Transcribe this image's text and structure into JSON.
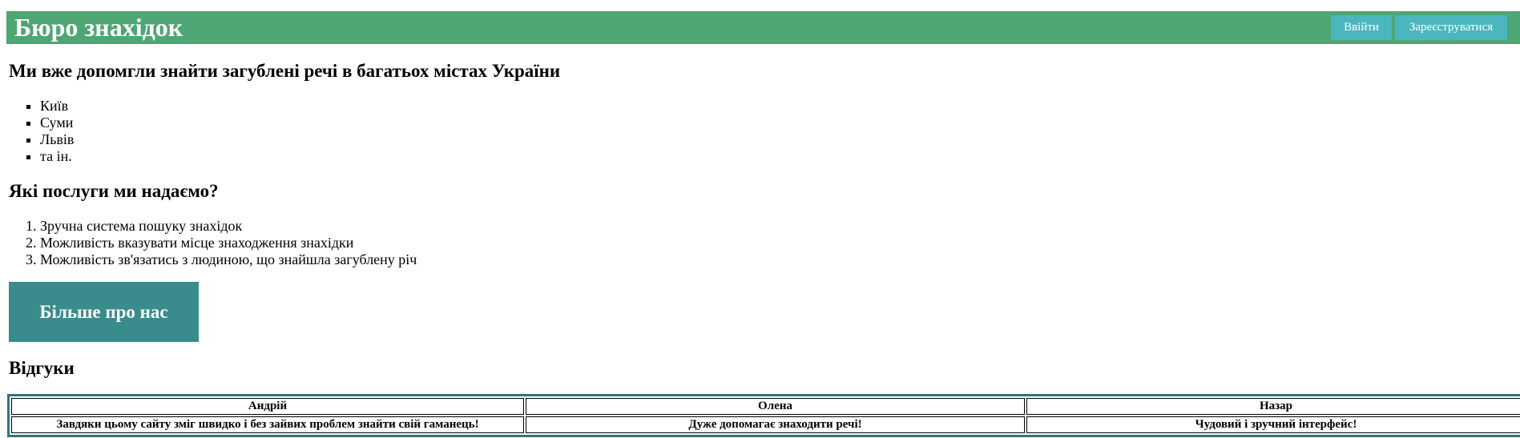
{
  "header": {
    "title": "Бюро знахідок",
    "login_label": "Ввійти",
    "signup_label": "Зареєструватися",
    "background_color": "#4da673",
    "button_color": "#4bb6be"
  },
  "cities": {
    "heading": "Ми вже допомгли знайти загублені речі в багатьох містах України",
    "items": [
      "Київ",
      "Суми",
      "Львів",
      "та ін."
    ]
  },
  "services": {
    "heading": "Які послуги ми надаємо?",
    "items": [
      "Зручна система пошуку знахідок",
      "Можливість вказувати місце знаходження знахідки",
      "Можливість зв'язатись з людиною, що знайшла загублену річ"
    ]
  },
  "more_button": {
    "label": "Більше про нас",
    "color": "#3a8b8c"
  },
  "reviews": {
    "heading": "Відгуки",
    "columns": [
      "Андрій",
      "Олена",
      "Назар"
    ],
    "rows": [
      [
        "Завдяки цьому сайту зміг швидко і без зайвих проблем знайти свій гаманець!",
        "Дуже допомагає знаходити речі!",
        "Чудовий і зручний інтерфейс!"
      ]
    ]
  }
}
